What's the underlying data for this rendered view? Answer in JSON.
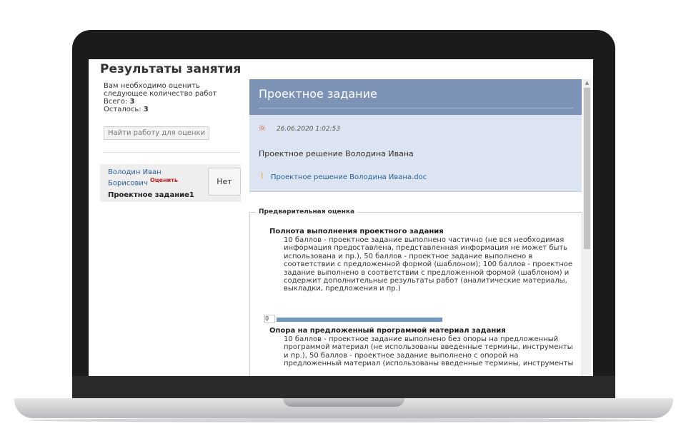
{
  "left": {
    "page_title": "Результаты занятия",
    "info_line1": "Вам необходимо оценить",
    "info_line2": "следующее количество работ",
    "total_label": "Всего: ",
    "total_value": "3",
    "remaining_label": "Осталось: ",
    "remaining_value": "3",
    "find_button": "Найти работу для оценки",
    "work": {
      "name_line1": "Володин Иван",
      "name_line2": "Борисович",
      "rate_link": "Оценить",
      "task": "Проектное задание1",
      "no_button": "Нет"
    }
  },
  "panel": {
    "title": "Проектное задание",
    "datetime": "26.06.2020 1:02:53",
    "solution_title": "Проектное решение Володина Ивана",
    "doc_link": "Проектное решение Володина Ивана.doc"
  },
  "assessment": {
    "legend": "Предварительная оценка",
    "criteria": [
      {
        "title": "Полнота выполнения проектного задания",
        "lines": [
          "10 баллов - проектное задание выполнено частично (не вся необходимая",
          "информация предоставлена, представленная информация не может быть",
          "использована и пр.), 50 баллов - проектное задание выполнено в",
          "соответствии с предложенной формой (шаблоном); 100 баллов - проектное",
          "задание выполнено в соответствии с предложенной формой (шаблоном) и",
          "содержит дополнительные результаты работ (аналитические материалы,",
          "выкладки, предложения и пр.)"
        ],
        "score": "0"
      },
      {
        "title": "Опора на предложенный программой материал задания",
        "lines": [
          "10 баллов - проектное задание выполнено без опоры на предложенный",
          "программой материал (не использованы введенные термины, инструменты",
          "и пр.), 50 баллов - проектное задание выполнено с опорой на",
          "предложенный материал (использованы введенные термины, инструменты"
        ]
      }
    ]
  },
  "icons": {
    "sun": "sun-icon",
    "clip": "paperclip-icon",
    "scroll_up": "scroll-up-icon"
  },
  "colors": {
    "header": "#7d93b6",
    "panel_body": "#dbe4f0",
    "link": "#2c5f9a",
    "rate": "#d01b1b"
  }
}
